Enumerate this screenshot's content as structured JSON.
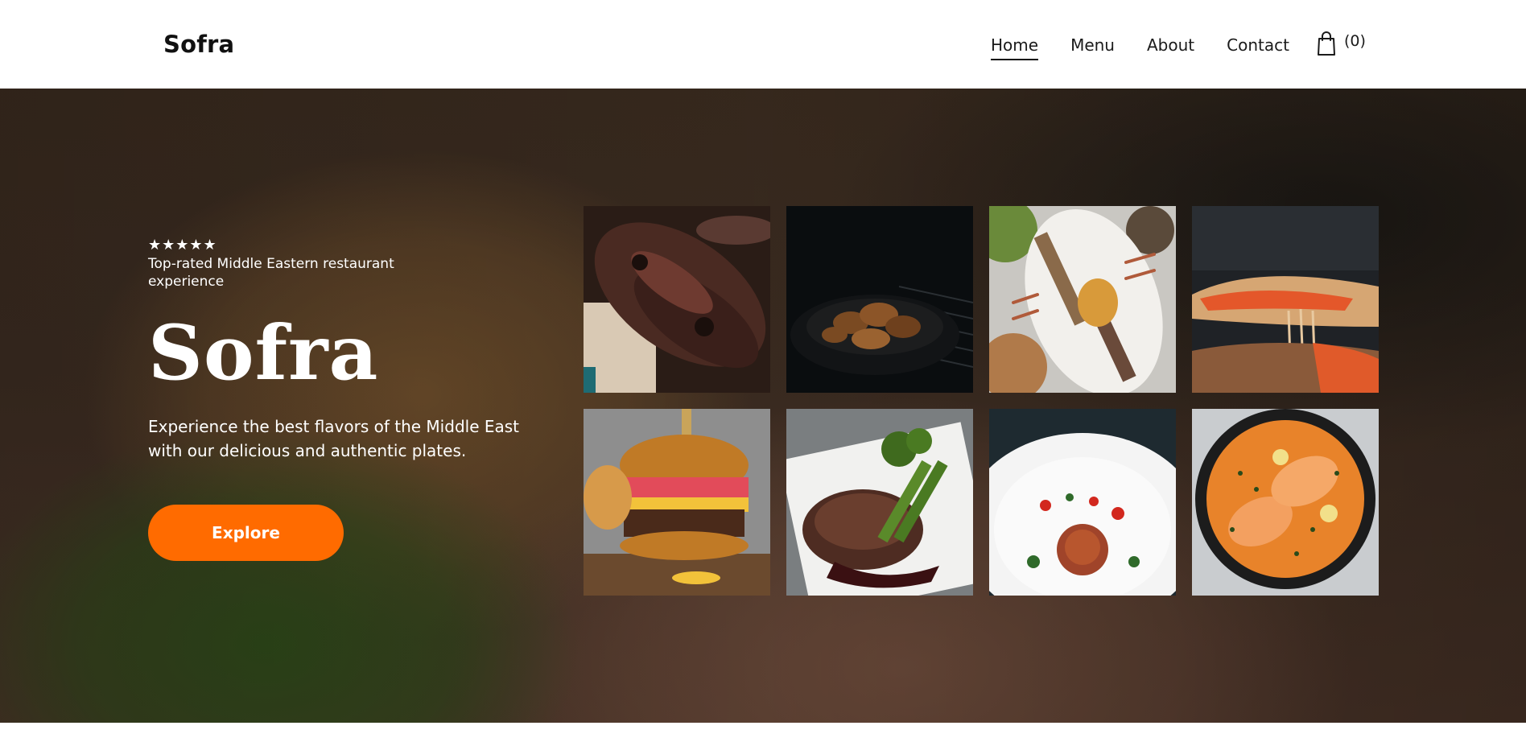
{
  "brand": {
    "name": "Sofra"
  },
  "nav": {
    "items": [
      {
        "label": "Home",
        "active": true
      },
      {
        "label": "Menu",
        "active": false
      },
      {
        "label": "About",
        "active": false
      },
      {
        "label": "Contact",
        "active": false
      }
    ],
    "cart": {
      "icon": "shopping-bag-icon",
      "count_text": "(0)"
    }
  },
  "hero": {
    "rating": {
      "stars": "★★★★★",
      "value": 5,
      "max": 5
    },
    "tagline": "Top-rated Middle Eastern restaurant experience",
    "title": "Sofra",
    "description": "Experience the best flavors of the Middle East with our delicious and authentic plates.",
    "cta_label": "Explore"
  },
  "gallery": {
    "tiles": [
      {
        "subject": "grilled-ribs-photo"
      },
      {
        "subject": "fried-chicken-skillet-photo"
      },
      {
        "subject": "skewers-platter-photo"
      },
      {
        "subject": "cheesy-flatbread-photo"
      },
      {
        "subject": "burger-photo"
      },
      {
        "subject": "steak-plate-photo"
      },
      {
        "subject": "spaghetti-plate-photo"
      },
      {
        "subject": "salmon-pan-photo"
      }
    ]
  },
  "colors": {
    "accent": "#ff6b00",
    "text_dark": "#111111",
    "hero_text": "#ffffff"
  }
}
